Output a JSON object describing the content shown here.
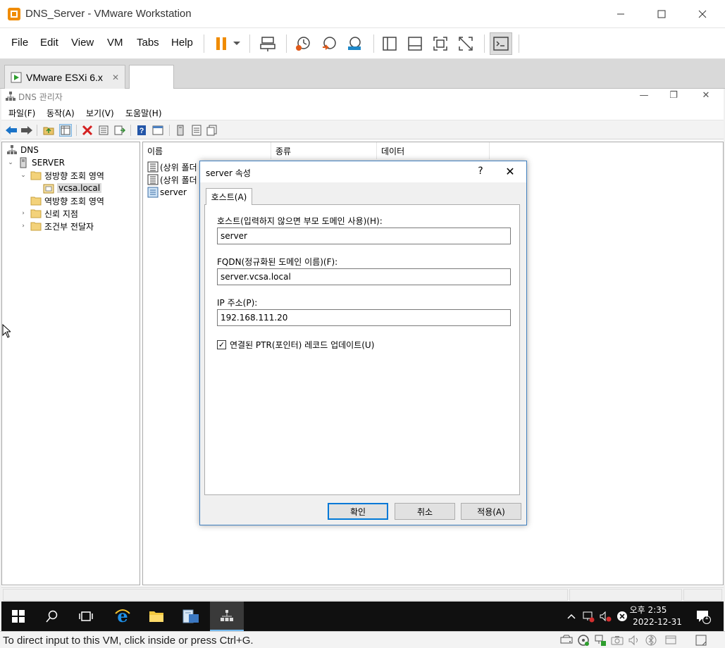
{
  "vmware": {
    "title": "DNS_Server - VMware Workstation",
    "menu": [
      "File",
      "Edit",
      "View",
      "VM",
      "Tabs",
      "Help"
    ],
    "tabs": [
      {
        "label": "VMware ESXi 6.x"
      },
      {
        "label": ""
      }
    ],
    "status_text": "To direct input to this VM, click inside or press Ctrl+G.",
    "accent": "#f08c00"
  },
  "dns_manager": {
    "title": "DNS 관리자",
    "menu": [
      "파일(F)",
      "동작(A)",
      "보기(V)",
      "도움말(H)"
    ],
    "tree": {
      "root": "DNS",
      "server": "SERVER",
      "forward_zone": "정방향 조회 영역",
      "zone": "vcsa.local",
      "reverse_zone": "역방향 조회 영역",
      "trust_points": "신뢰 지점",
      "conditional_forwarders": "조건부 전달자"
    },
    "columns": [
      "이름",
      "종류",
      "데이터"
    ],
    "rows": [
      "(상위 폴더",
      "(상위 폴더",
      "server"
    ]
  },
  "dialog": {
    "title": "server 속성",
    "help": "?",
    "close": "✕",
    "tab": "호스트(A)",
    "host_label": "호스트(입력하지 않으면 부모 도메인 사용)(H):",
    "host_value": "server",
    "fqdn_label": "FQDN(정규화된 도메인 이름)(F):",
    "fqdn_value": "server.vcsa.local",
    "ip_label": "IP 주소(P):",
    "ip_value": "192.168.111.20",
    "ptr_label": "연결된 PTR(포인터) 레코드 업데이트(U)",
    "ptr_checked": true,
    "ok": "확인",
    "cancel": "취소",
    "apply": "적용(A)"
  },
  "taskbar": {
    "time": "오후 2:35",
    "date": "2022-12-31",
    "notification_count": "1"
  }
}
